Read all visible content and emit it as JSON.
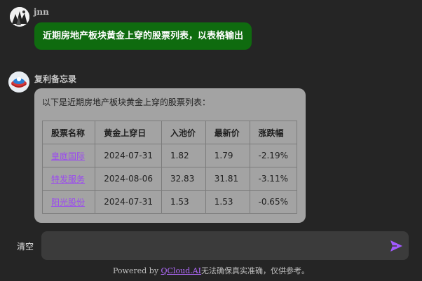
{
  "user": {
    "name": "jnn",
    "message": "近期房地产板块黄金上穿的股票列表，以表格输出",
    "bubble_color": "#0f6b0f"
  },
  "bot": {
    "name": "复利备忘录",
    "intro": "以下是近期房地产板块黄金上穿的股票列表：",
    "bubble_color": "#a3a3a3",
    "table": {
      "headers": [
        "股票名称",
        "黄金上穿日",
        "入池价",
        "最新价",
        "涨跌幅"
      ],
      "rows": [
        [
          "皇庭国际",
          "2024-07-31",
          "1.82",
          "1.79",
          "-2.19%"
        ],
        [
          "特发服务",
          "2024-08-06",
          "32.83",
          "31.81",
          "-3.11%"
        ],
        [
          "阳光股份",
          "2024-07-31",
          "1.53",
          "1.53",
          "-0.65%"
        ]
      ],
      "link_color": "#9b49f0"
    }
  },
  "input": {
    "clear_label": "清空",
    "placeholder": "",
    "send_icon": "send-arrow-icon",
    "send_color": "#a259ff"
  },
  "footer": {
    "prefix": "Powered by ",
    "link_text": "QCloud.AI",
    "suffix": "无法确保真实准确，仅供参考。"
  }
}
